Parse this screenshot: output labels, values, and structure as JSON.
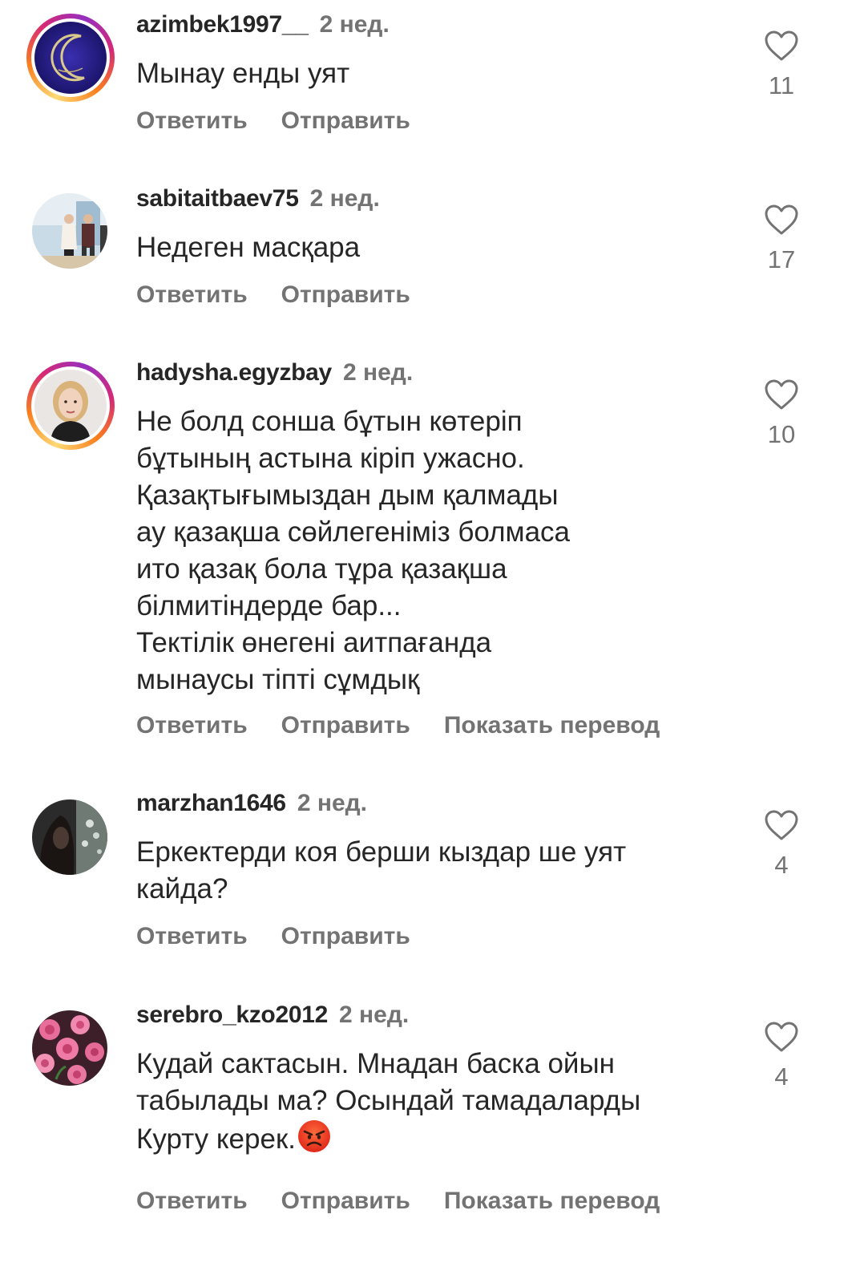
{
  "comments": [
    {
      "username": "azimbek1997__",
      "time": "2 нед.",
      "text": "Мынау енды уят",
      "likes": "11",
      "actions": [
        "Ответить",
        "Отправить"
      ],
      "has_story": true,
      "avatar_icon": "crescent-moon-icon"
    },
    {
      "username": "sabitaitbaev75",
      "time": "2 нед.",
      "text": "Недеген масқара",
      "likes": "17",
      "actions": [
        "Ответить",
        "Отправить"
      ],
      "has_story": false,
      "avatar_icon": "people-photo"
    },
    {
      "username": "hadysha.egyzbay",
      "time": "2 нед.",
      "text": "Не болд сонша бұтын көтеріп\nбұтының астына кіріп ужасно.\nҚазақтығымыздан дым қалмады\nау қазақша сөйлегеніміз болмаса\nито қазақ  бола тұра қазақша\nбілмитіндерде бар...\nТектілік өнегені аитпағанда\n мынаусы тіпті сұмдық",
      "likes": "10",
      "actions": [
        "Ответить",
        "Отправить",
        "Показать перевод"
      ],
      "has_story": true,
      "avatar_icon": "woman-portrait"
    },
    {
      "username": "marzhan1646",
      "time": "2 нед.",
      "text": "Еркектерди коя берши кыздар ше уят\nкайда?",
      "likes": "4",
      "actions": [
        "Ответить",
        "Отправить"
      ],
      "has_story": false,
      "avatar_icon": "dark-photo"
    },
    {
      "username": "serebro_kzo2012",
      "time": "2 нед.",
      "text": "Кудай сактасын. Мнадан баска ойын\nтабылады ма? Осындай тамадаларды\nКурту керек.",
      "likes": "4",
      "actions": [
        "Ответить",
        "Отправить",
        "Показать перевод"
      ],
      "has_story": false,
      "avatar_icon": "roses-photo",
      "trailing_emoji": "angry-face-emoji"
    }
  ],
  "colors": {
    "text_primary": "#262626",
    "text_secondary": "#737373",
    "background": "#ffffff"
  }
}
